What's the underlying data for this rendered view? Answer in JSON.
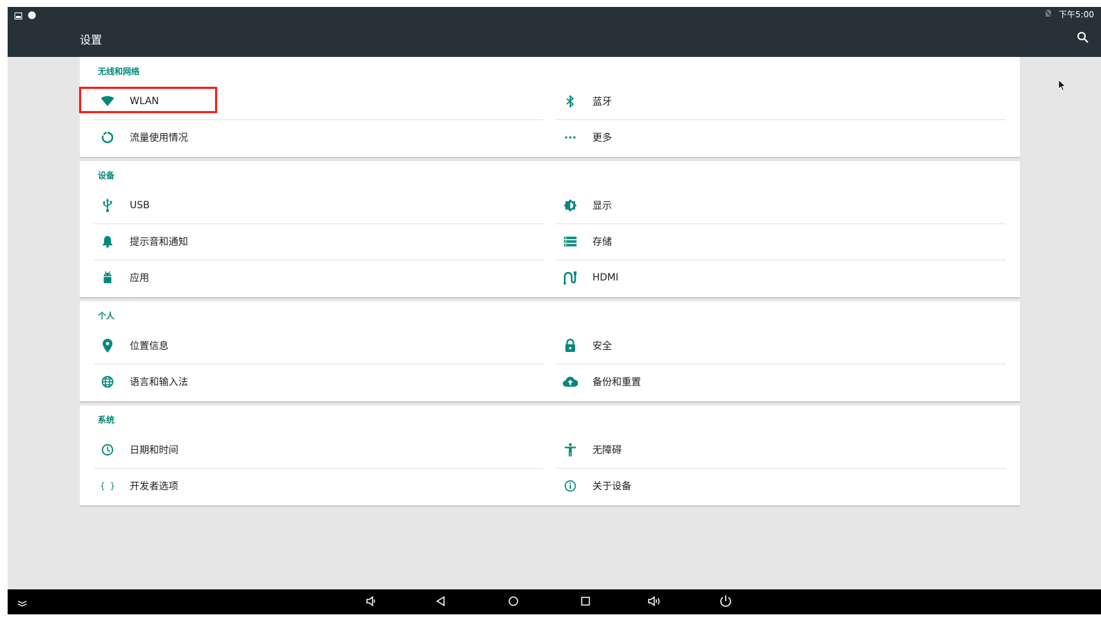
{
  "status_bar": {
    "time": "下午5:00"
  },
  "app_bar": {
    "title": "设置"
  },
  "sections": [
    {
      "title": "无线和网络",
      "items": [
        {
          "label": "WLAN",
          "icon": "wifi-icon"
        },
        {
          "label": "蓝牙",
          "icon": "bluetooth-icon"
        },
        {
          "label": "流量使用情况",
          "icon": "data-usage-icon"
        },
        {
          "label": "更多",
          "icon": "more-icon"
        }
      ]
    },
    {
      "title": "设备",
      "items": [
        {
          "label": "USB",
          "icon": "usb-icon"
        },
        {
          "label": "显示",
          "icon": "display-icon"
        },
        {
          "label": "提示音和通知",
          "icon": "bell-icon"
        },
        {
          "label": "存储",
          "icon": "storage-icon"
        },
        {
          "label": "应用",
          "icon": "android-icon"
        },
        {
          "label": "HDMI",
          "icon": "hdmi-icon"
        }
      ]
    },
    {
      "title": "个人",
      "items": [
        {
          "label": "位置信息",
          "icon": "location-icon"
        },
        {
          "label": "安全",
          "icon": "lock-icon"
        },
        {
          "label": "语言和输入法",
          "icon": "globe-icon"
        },
        {
          "label": "备份和重置",
          "icon": "cloud-upload-icon"
        }
      ]
    },
    {
      "title": "系统",
      "items": [
        {
          "label": "日期和时间",
          "icon": "clock-icon"
        },
        {
          "label": "无障碍",
          "icon": "accessibility-icon"
        },
        {
          "label": "开发者选项",
          "icon": "code-braces-icon",
          "glyph": "{ }"
        },
        {
          "label": "关于设备",
          "icon": "info-icon"
        }
      ]
    }
  ],
  "colors": {
    "accent": "#00897b",
    "app_bar": "#263238",
    "highlight": "#ff1a1a"
  }
}
